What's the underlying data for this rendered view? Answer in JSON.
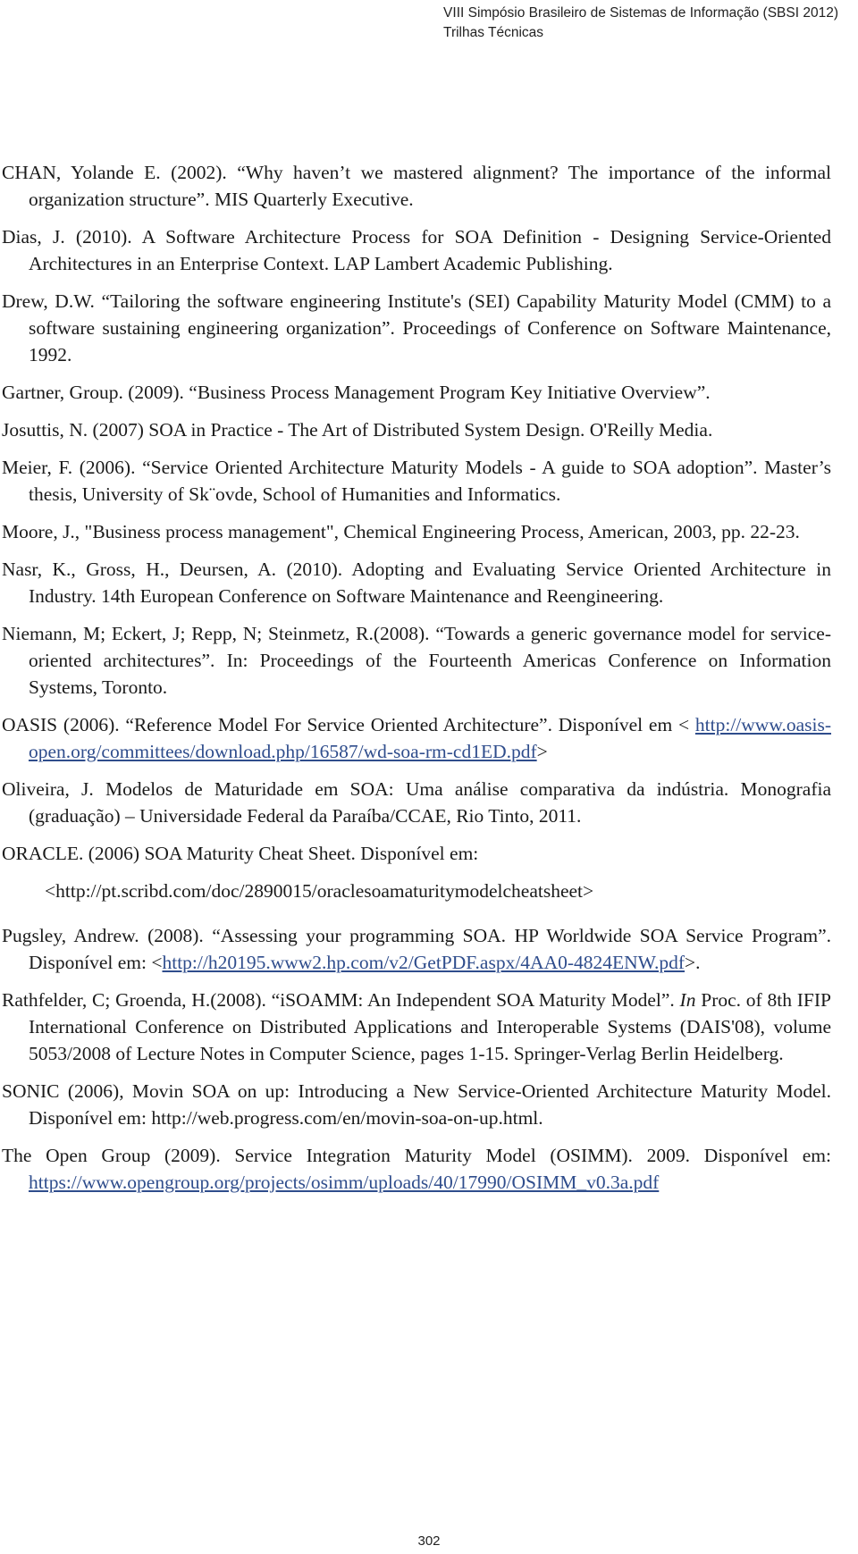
{
  "header": {
    "line1": "VIII Simpósio Brasileiro de Sistemas de Informação (SBSI 2012)",
    "line2": "Trilhas Técnicas"
  },
  "references": [
    {
      "text": "CHAN, Yolande E. (2002). “Why haven’t we mastered alignment? The importance of the informal organization structure”. MIS Quarterly Executive."
    },
    {
      "text": "Dias, J. (2010). A Software Architecture Process for SOA Definition - Designing Service-Oriented Architectures in an Enterprise Context. LAP Lambert Academic Publishing."
    },
    {
      "text": "Drew, D.W. “Tailoring the software engineering Institute's (SEI) Capability Maturity Model (CMM) to a software sustaining engineering organization”. Proceedings of Conference on Software Maintenance, 1992."
    },
    {
      "text": "Gartner, Group. (2009). “Business Process Management Program Key Initiative Overview”."
    },
    {
      "text": "Josuttis, N. (2007) SOA in Practice - The Art of Distributed System Design. O'Reilly Media."
    },
    {
      "text": "Meier, F. (2006). “Service Oriented Architecture Maturity Models - A guide to SOA adoption”. Master’s thesis, University of Sk¨ovde, School of Humanities and Informatics."
    },
    {
      "text": "Moore, J., \"Business process management\", Chemical Engineering Process, American, 2003, pp. 22-23."
    },
    {
      "text": "Nasr, K., Gross, H., Deursen, A. (2010). Adopting and Evaluating Service Oriented Architecture in Industry. 14th European Conference on Software Maintenance and Reengineering."
    },
    {
      "text": "Niemann, M; Eckert, J; Repp, N; Steinmetz, R.(2008). “Towards a generic  governance model for service-oriented architectures”. In: Proceedings of the Fourteenth Americas Conference on Information Systems, Toronto."
    },
    {
      "text": "OASIS (2006). “Reference Model For Service Oriented Architecture”. Disponível em < ",
      "link": "http://www.oasis-open.org/committees/download.php/16587/wd-soa-rm-cd1ED.pdf",
      "after": ">"
    },
    {
      "text": "Oliveira, J. Modelos de Maturidade em SOA: Uma análise comparativa da indústria. Monografia (graduação) – Universidade Federal da Paraíba/CCAE, Rio Tinto, 2011."
    },
    {
      "text": "ORACLE. (2006) SOA Maturity Cheat Sheet. Disponível em:",
      "url_line": "<http://pt.scribd.com/doc/2890015/oraclesoamaturitymodelcheatsheet>"
    },
    {
      "text": "Pugsley, Andrew. (2008). “Assessing your programming SOA. HP Worldwide SOA Service Program”. Disponível em: <",
      "link": "http://h20195.www2.hp.com/v2/GetPDF.aspx/4AA0-4824ENW.pdf",
      "after": ">."
    },
    {
      "text": "Rathfelder, C; Groenda, H.(2008). “iSOAMM: An Independent SOA Maturity Model”. ",
      "italic": "In",
      "text2": " Proc. of 8th IFIP International Conference on Distributed Applications and Interoperable Systems (DAIS'08), volume 5053/2008 of Lecture Notes in Computer Science, pages 1-15. Springer-Verlag Berlin Heidelberg."
    },
    {
      "text": "SONIC (2006), Movin SOA on up: Introducing a New Service-Oriented Architecture Maturity Model. Disponível em: http://web.progress.com/en/movin-soa-on-up.html."
    },
    {
      "text": "The Open Group (2009). Service Integration Maturity Model (OSIMM). 2009. Disponível em: ",
      "link": "https://www.opengroup.org/projects/osimm/uploads/40/17990/OSIMM_v0.3a.pdf",
      "after": ""
    }
  ],
  "page_number": "302",
  "colors": {
    "link": "#2f4d8c",
    "text": "#1a1a1a"
  }
}
